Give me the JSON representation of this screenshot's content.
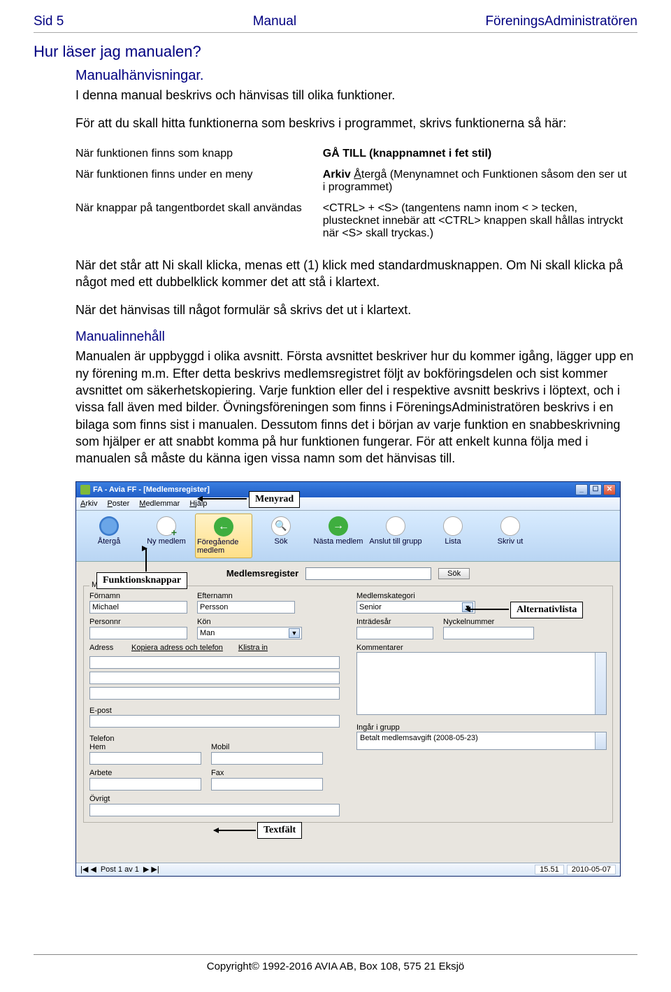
{
  "header": {
    "left": "Sid 5",
    "center": "Manual",
    "right": "FöreningsAdministratören"
  },
  "title": "Hur läser jag manualen?",
  "sub1": "Manualhänvisningar.",
  "intro1": "I denna manual beskrivs och hänvisas till olika funktioner.",
  "intro2": "För att du skall hitta funktionerna som beskrivs i programmet, skrivs funktionerna så här:",
  "rows": [
    {
      "l": "När funktionen finns som knapp",
      "r": "GÅ TILL (knappnamnet i fet stil)",
      "bold": true
    },
    {
      "l": "När funktionen finns under en meny",
      "r": "Arkiv Återgå (Menynamnet och Funktionen såsom den ser ut i programmet)"
    },
    {
      "l": "När knappar på tangentbordet skall användas",
      "r": "<CTRL> + <S> (tangentens namn inom < > tecken, plustecknet innebär att <CTRL> knappen skall hållas intryckt när <S> skall tryckas.)"
    }
  ],
  "para1": "När det står att Ni skall klicka, menas ett (1) klick med standardmusknappen. Om Ni skall klicka på något med ett dubbelklick kommer det att stå i klartext.",
  "para2": "När det hänvisas till något formulär så skrivs det ut i klartext.",
  "sec2": "Manualinnehåll",
  "para3": "Manualen är uppbyggd i olika avsnitt. Första avsnittet beskriver hur du kommer igång, lägger upp en ny förening m.m. Efter detta beskrivs medlemsregistret följt av bokföringsdelen och sist kommer avsnittet om säkerhetskopiering. Varje funktion eller del i respektive avsnitt beskrivs i löptext, och i vissa fall även med bilder. Övningsföreningen som finns i FöreningsAdministratören beskrivs i en bilaga som finns sist i manualen. Dessutom finns det i början av varje funktion en snabbeskrivning som hjälper er att snabbt komma på hur funktionen fungerar. För att enkelt kunna följa med i manualen så måste du känna igen vissa namn som det hänvisas till.",
  "annot": {
    "menyrad": "Menyrad",
    "funktionsknappar": "Funktionsknappar",
    "alternativlista": "Alternativlista",
    "textfalt": "Textfält"
  },
  "app": {
    "title": "FA - Avia FF - [Medlemsregister]",
    "menu": [
      "Arkiv",
      "Poster",
      "Medlemmar",
      "Hjälp"
    ],
    "toolbar": [
      {
        "label": "Återgå"
      },
      {
        "label": "Ny medlem"
      },
      {
        "label": "Föregående medlem"
      },
      {
        "label": "Sök"
      },
      {
        "label": "Nästa medlem"
      },
      {
        "label": "Anslut till grupp"
      },
      {
        "label": "Lista"
      },
      {
        "label": "Skriv ut"
      }
    ],
    "searchLabel": "Medlemsregister",
    "sokBtn": "Sök",
    "legend": "Medlem nr 1",
    "labels": {
      "fornamn": "Förnamn",
      "efternamn": "Efternamn",
      "medlemskategori": "Medlemskategori",
      "personnr": "Personnr",
      "kon": "Kön",
      "intradesar": "Inträdesår",
      "nyckelnummer": "Nyckelnummer",
      "adress": "Adress",
      "kopiera": "Kopiera adress och telefon",
      "klistra": "Klistra in",
      "kommentarer": "Kommentarer",
      "epost": "E-post",
      "ingar": "Ingår i grupp",
      "betalt": "Betalt medlemsavgift (2008-05-23)",
      "telefon": "Telefon",
      "hem": "Hem",
      "mobil": "Mobil",
      "arbete": "Arbete",
      "fax": "Fax",
      "ovrigt": "Övrigt"
    },
    "values": {
      "fornamn": "Michael",
      "efternamn": "Persson",
      "kon": "Man",
      "medlemskategori": "Senior"
    },
    "status": {
      "post": "Post 1 av 1",
      "time": "15.51",
      "date": "2010-05-07"
    }
  },
  "footer": "Copyright© 1992-2016 AVIA AB, Box 108, 575 21  Eksjö"
}
